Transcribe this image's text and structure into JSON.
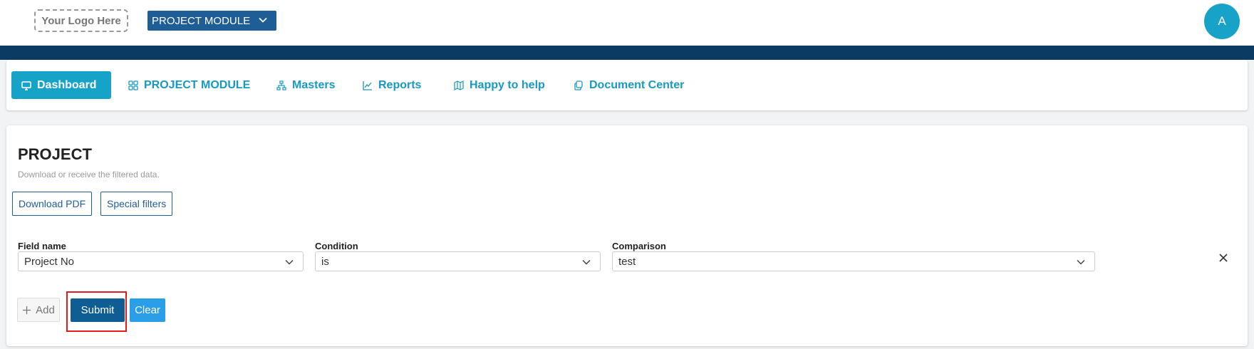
{
  "header": {
    "logo_text": "Your Logo Here",
    "module_select_value": "PROJECT MODULE",
    "avatar_initial": "A"
  },
  "nav": {
    "items": [
      {
        "label": "Dashboard",
        "icon": "monitor-icon",
        "active": true
      },
      {
        "label": "PROJECT MODULE",
        "icon": "grid-icon",
        "active": false
      },
      {
        "label": "Masters",
        "icon": "sitemap-icon",
        "active": false
      },
      {
        "label": "Reports",
        "icon": "line-chart-icon",
        "active": false
      },
      {
        "label": "Happy to help",
        "icon": "map-icon",
        "active": false
      },
      {
        "label": "Document Center",
        "icon": "copy-icon",
        "active": false
      }
    ]
  },
  "page": {
    "title": "PROJECT",
    "subtitle": "Download or receive the filtered data.",
    "download_pdf_label": "Download PDF",
    "special_filters_label": "Special filters"
  },
  "filter": {
    "field_name_label": "Field name",
    "field_name_value": "Project No",
    "condition_label": "Condition",
    "condition_value": "is",
    "comparison_label": "Comparison",
    "comparison_value": "test"
  },
  "actions": {
    "add_label": "Add",
    "submit_label": "Submit",
    "clear_label": "Clear"
  },
  "colors": {
    "primary_dark": "#0b3a63",
    "accent_teal": "#17a2c8",
    "button_blue": "#0f5e93",
    "clear_blue": "#2b9ee8",
    "highlight_red": "#e51b1b"
  }
}
